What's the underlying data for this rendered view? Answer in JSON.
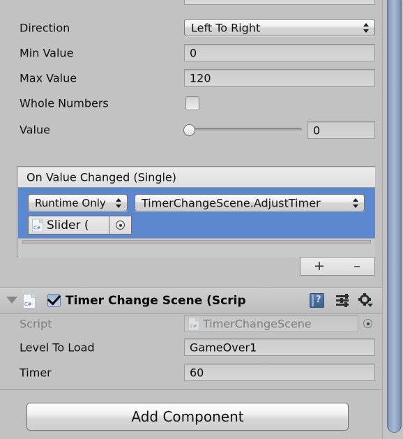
{
  "inspector": {
    "slider_properties": [
      {
        "label": "Direction",
        "type": "dropdown",
        "value": "Left To Right"
      },
      {
        "label": "Min Value",
        "type": "text",
        "value": "0"
      },
      {
        "label": "Max Value",
        "type": "text",
        "value": "120"
      },
      {
        "label": "Whole Numbers",
        "type": "checkbox",
        "checked": false
      },
      {
        "label": "Value",
        "type": "slider",
        "value": "0"
      }
    ],
    "event_block": {
      "title": "On Value Changed (Single)",
      "entry": {
        "callback_state": "Runtime Only",
        "function": "TimerChangeScene.AdjustTimer",
        "object_reference": "Slider (",
        "object_icon": "csharp-script-icon",
        "picker_icon": "object-picker-icon"
      },
      "add_label": "+",
      "remove_label": "–"
    },
    "component": {
      "foldout_icon": "foldout-expanded-icon",
      "script_icon": "csharp-script-icon",
      "enabled": true,
      "title": "Timer Change Scene (Scrip",
      "help_icon": "help-book-icon",
      "preset_icon": "preset-sliders-icon",
      "gear_icon": "gear-dropdown-icon",
      "fields": [
        {
          "label": "Script",
          "value": "TimerChangeScene",
          "dimmed": true,
          "icon": "csharp-script-icon",
          "picker": "object-picker-icon"
        },
        {
          "label": "Level To Load",
          "value": "GameOver1",
          "dimmed": false
        },
        {
          "label": "Timer",
          "value": "60",
          "dimmed": false
        }
      ]
    },
    "add_component_label": "Add Component",
    "scrollbar": {
      "name": "vertical-scrollbar"
    },
    "colors": {
      "background": "#c2c2c2",
      "selection_blue": "#5b87ce",
      "scrollbar_blue": "#93a8c8",
      "label_text": "#101010",
      "dim_text": "#7d7d7d"
    }
  }
}
